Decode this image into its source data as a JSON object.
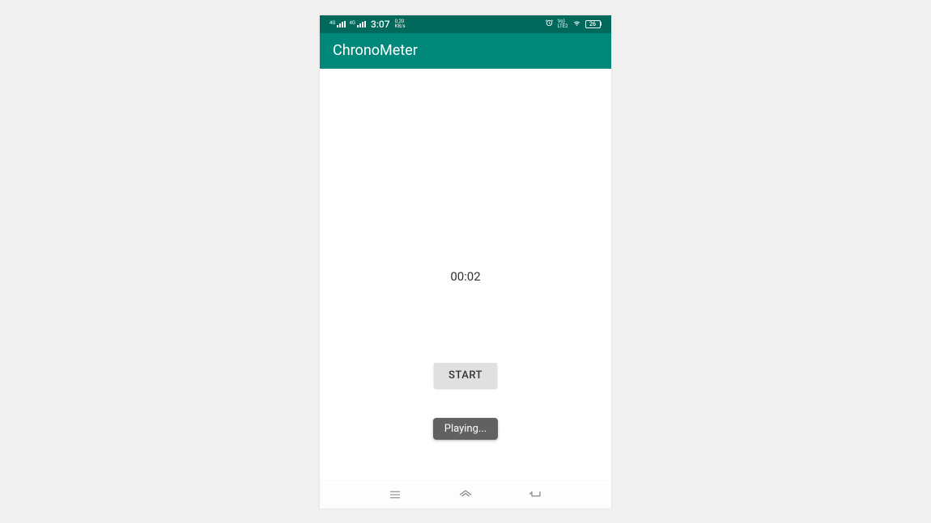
{
  "statusBar": {
    "network1": "4G",
    "network2": "4G",
    "time": "3:07",
    "dataRateTop": "0.20",
    "dataRateBottom": "KB/s",
    "volteTop": "Vo)",
    "volteBottom": "LTE2",
    "batteryLevel": "26"
  },
  "appBar": {
    "title": "ChronoMeter"
  },
  "content": {
    "timerValue": "00:02",
    "startButtonLabel": "START",
    "toastMessage": "Playing..."
  },
  "colors": {
    "statusBarBg": "#00695c",
    "appBarBg": "#00897b"
  }
}
